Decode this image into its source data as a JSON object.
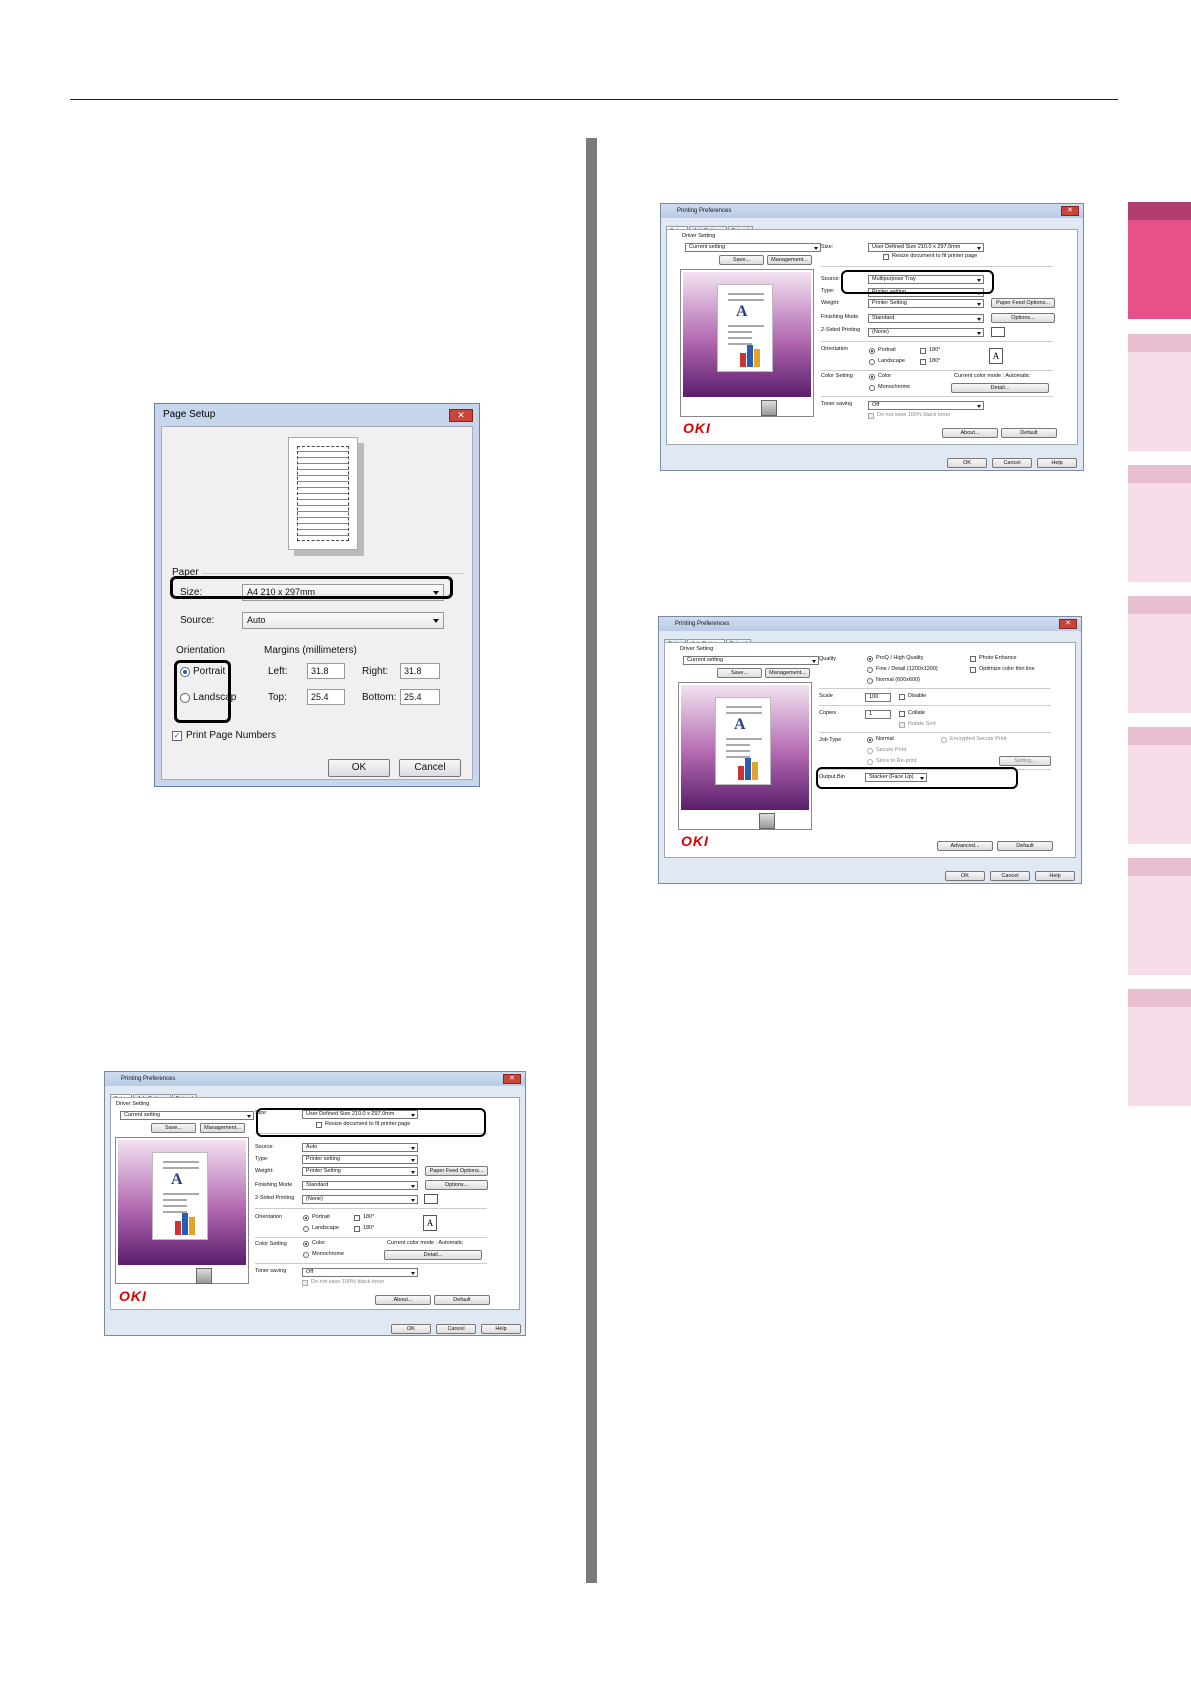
{
  "page_setup": {
    "title": "Page Setup",
    "paper_label": "Paper",
    "size_label": "Size:",
    "size_value": "A4 210 x 297mm",
    "source_label": "Source:",
    "source_value": "Auto",
    "orientation_label": "Orientation",
    "portrait": "Portrait",
    "landscape": "Landscap",
    "margins_label": "Margins (millimeters)",
    "left_label": "Left:",
    "left_value": "31.8",
    "right_label": "Right:",
    "right_value": "31.8",
    "top_label": "Top:",
    "top_value": "25.4",
    "bottom_label": "Bottom:",
    "bottom_value": "25.4",
    "print_page_numbers": "Print Page Numbers",
    "ok": "OK",
    "cancel": "Cancel"
  },
  "pp_common": {
    "title": "Printing Preferences",
    "tab_setup": "Setup",
    "tab_job": "Job Options",
    "tab_extend": "Extend",
    "driver_setting": "Driver Setting",
    "current_setting": "Current setting",
    "save": "Save...",
    "management": "Management...",
    "ok": "OK",
    "cancel": "Cancel",
    "help": "Help",
    "about": "About...",
    "default": "Default",
    "advanced": "Advanced...",
    "logo": "OKI",
    "close": "✕"
  },
  "pp_setup": {
    "size_label": "Size:",
    "size_value": "User Defined Size 210.0 x 297.0mm",
    "resize": "Resize document to fit printer page",
    "source_label": "Source:",
    "source_auto": "Auto",
    "source_mp": "Multipurpose Tray",
    "type_label": "Type:",
    "type_value": "Printer setting",
    "weight_label": "Weight:",
    "weight_value": "Printer Setting",
    "paper_feed": "Paper Feed Options...",
    "finishing_label": "Finishing Mode",
    "finishing_value": "Standard",
    "options": "Options...",
    "two_sided_label": "2-Sided Printing",
    "two_sided_value": "(None)",
    "orientation_label": "Orientation",
    "portrait": "Portrait",
    "landscape": "Landscape",
    "rot180": "180°",
    "color_label": "Color Setting",
    "color": "Color",
    "mono": "Monochrome",
    "color_mode": "Current color mode : Automatic",
    "detail": "Detail...",
    "toner_label": "Toner saving",
    "toner_value": "Off",
    "toner_black": "Do not save 100% black toner"
  },
  "pp_job": {
    "quality_label": "Quality",
    "q1": "ProQ / High Quality",
    "q2": "Fine / Detail (1200x1200)",
    "q3": "Normal (600x600)",
    "photo": "Photo Enhance",
    "optimize": "Optimize color thin line",
    "scale_label": "Scale",
    "scale_value": "100",
    "disable": "Disable",
    "copies_label": "Copies",
    "copies_value": "1",
    "collate": "Collate",
    "rotate_sort": "Rotate Sort",
    "job_type_label": "Job Type",
    "normal": "Normal",
    "secure": "Secure Print",
    "store": "Store to Re-print",
    "encrypted": "Encrypted Secure Print",
    "setting": "Setting...",
    "output_label": "Output Bin",
    "output_value": "Stacker (Face Up)"
  }
}
